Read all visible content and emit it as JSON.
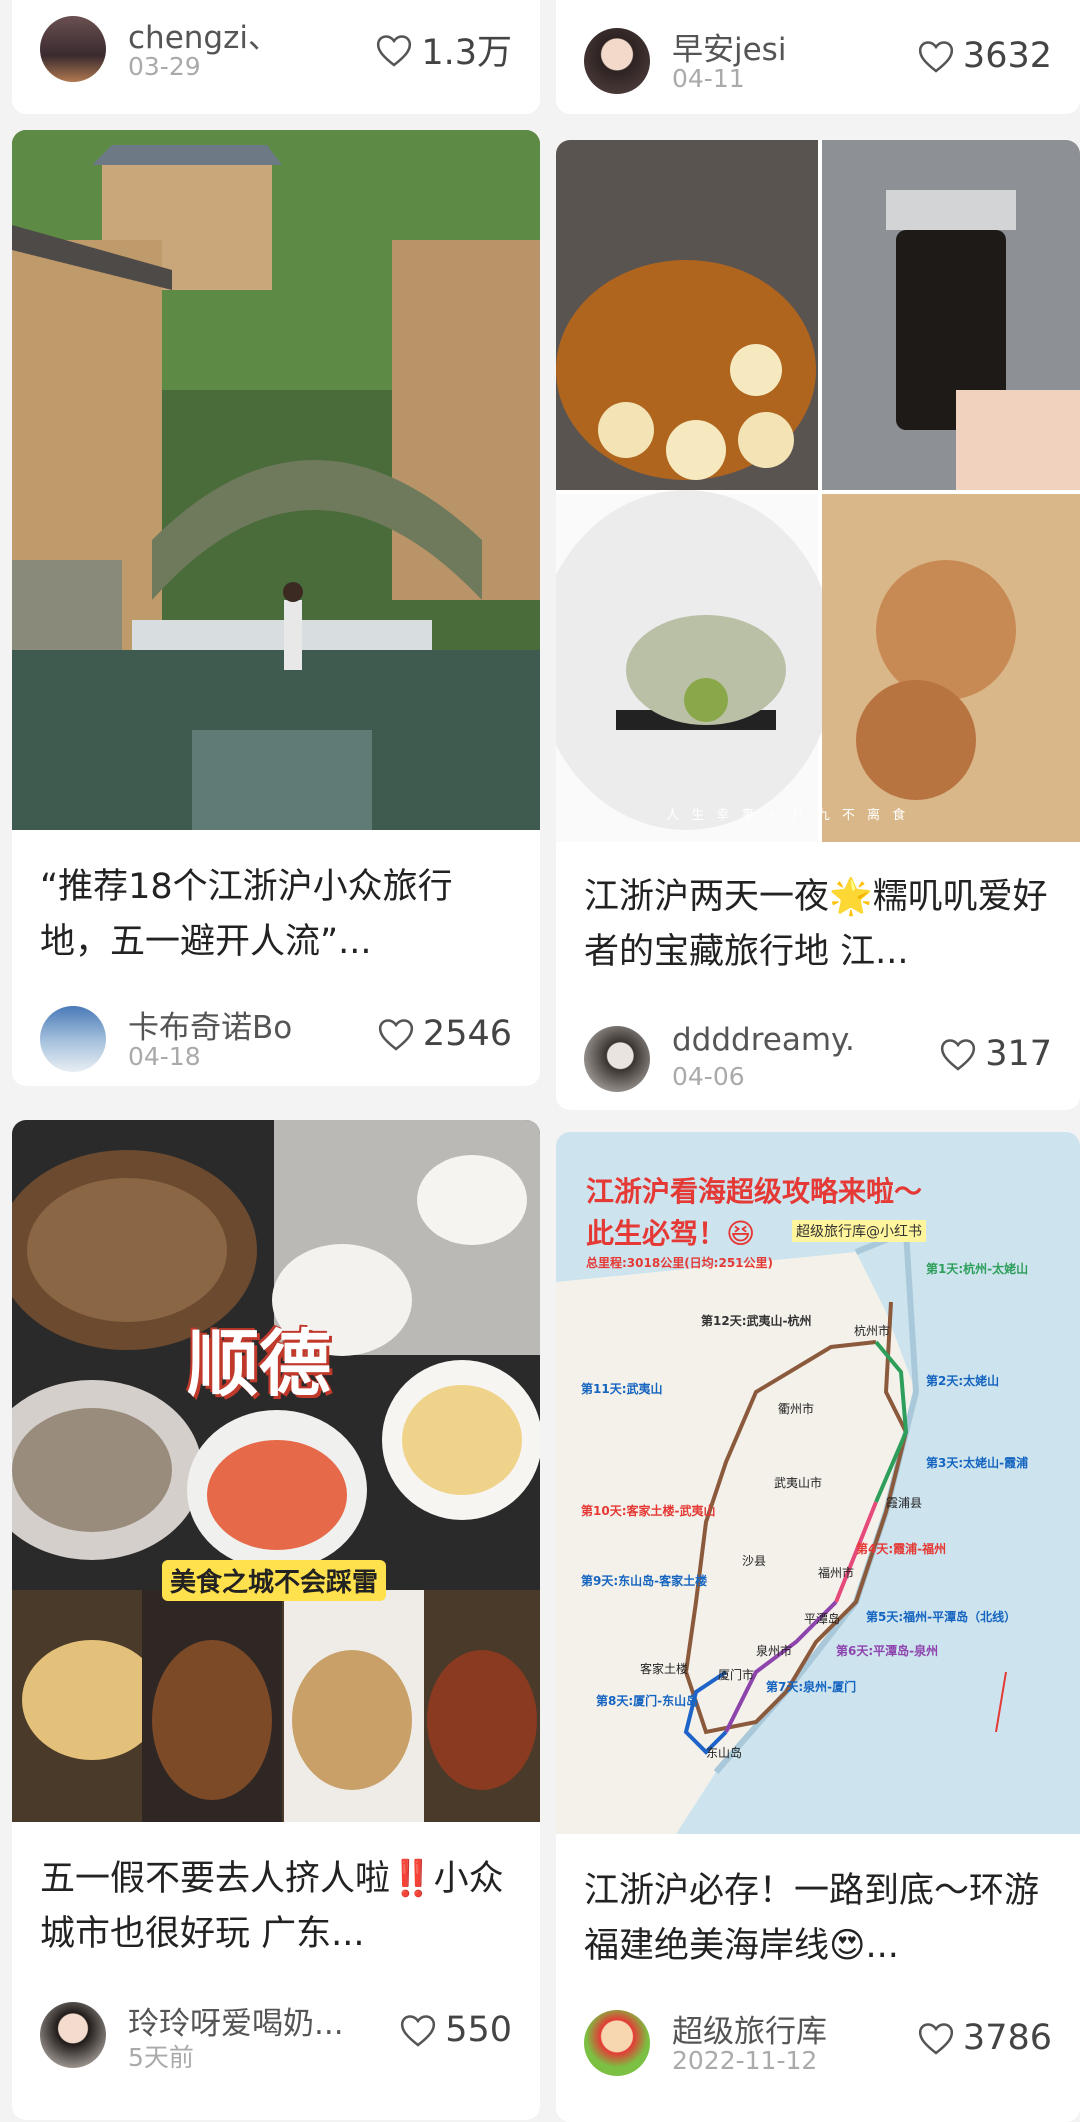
{
  "cards": [
    {
      "username": "chengzi、",
      "date": "03-29",
      "likes": "1.3万"
    },
    {
      "username": "早安jesi",
      "date": "04-11",
      "likes": "3632"
    },
    {
      "title": "“推荐18个江浙沪小众旅行地，五一避开人流”...",
      "username": "卡布奇诺Bo",
      "date": "04-18",
      "likes": "2546"
    },
    {
      "title": "江浙沪两天一夜🌟糯叽叽爱好者的宝藏旅行地 江...",
      "username": "ddddreamy.",
      "date": "04-06",
      "likes": "317",
      "img_caption": "人 生 幸 事 ・ 八 九 不 离 食"
    },
    {
      "title": "五一假不要去人挤人啦‼️小众城市也很好玩 广东...",
      "username": "玲玲呀爱喝奶...",
      "date": "5天前",
      "likes": "550",
      "img_title": "顺德",
      "img_subtitle": "美食之城不会踩雷"
    },
    {
      "title": "江浙沪必存！一路到底～环游福建绝美海岸线😍...",
      "username": "超级旅行库",
      "date": "2022-11-12",
      "likes": "3786",
      "map": {
        "title1": "江浙沪看海超级攻略来啦～",
        "title2": "此生必驾！😆",
        "tag": "超级旅行库@小红书",
        "total": "总里程:3018公里(日均:251公里)",
        "day1": "第1天:杭州-太姥山",
        "day12": "第12天:武夷山-杭州",
        "day11": "第11天:武夷山",
        "day2": "第2天:太姥山",
        "day3": "第3天:太姥山-霞浦",
        "day10": "第10天:客家土楼-武夷山",
        "day4": "第4天:霞浦-福州",
        "day9": "第9天:东山岛-客家土楼",
        "day5": "第5天:福州-平潭岛（北线）",
        "day6": "第6天:平潭岛-泉州",
        "day7": "第7天:泉州-厦门",
        "day8": "第8天:厦门-东山岛",
        "c_hangzhou": "杭州市",
        "c_quzhou": "衢州市",
        "c_wuyi": "武夷山市",
        "c_xiapu": "霞浦县",
        "c_fuzhou": "福州市",
        "c_pingtan": "平潭岛",
        "c_shaxian": "沙县",
        "c_quanzhou": "泉州市",
        "c_xiamen": "厦门市",
        "c_kejia": "客家土楼",
        "c_dongshan": "东山岛"
      }
    }
  ],
  "colors": {
    "map_title": "#e53935",
    "map_day": "#1565c0",
    "like_heart": "#555555"
  }
}
